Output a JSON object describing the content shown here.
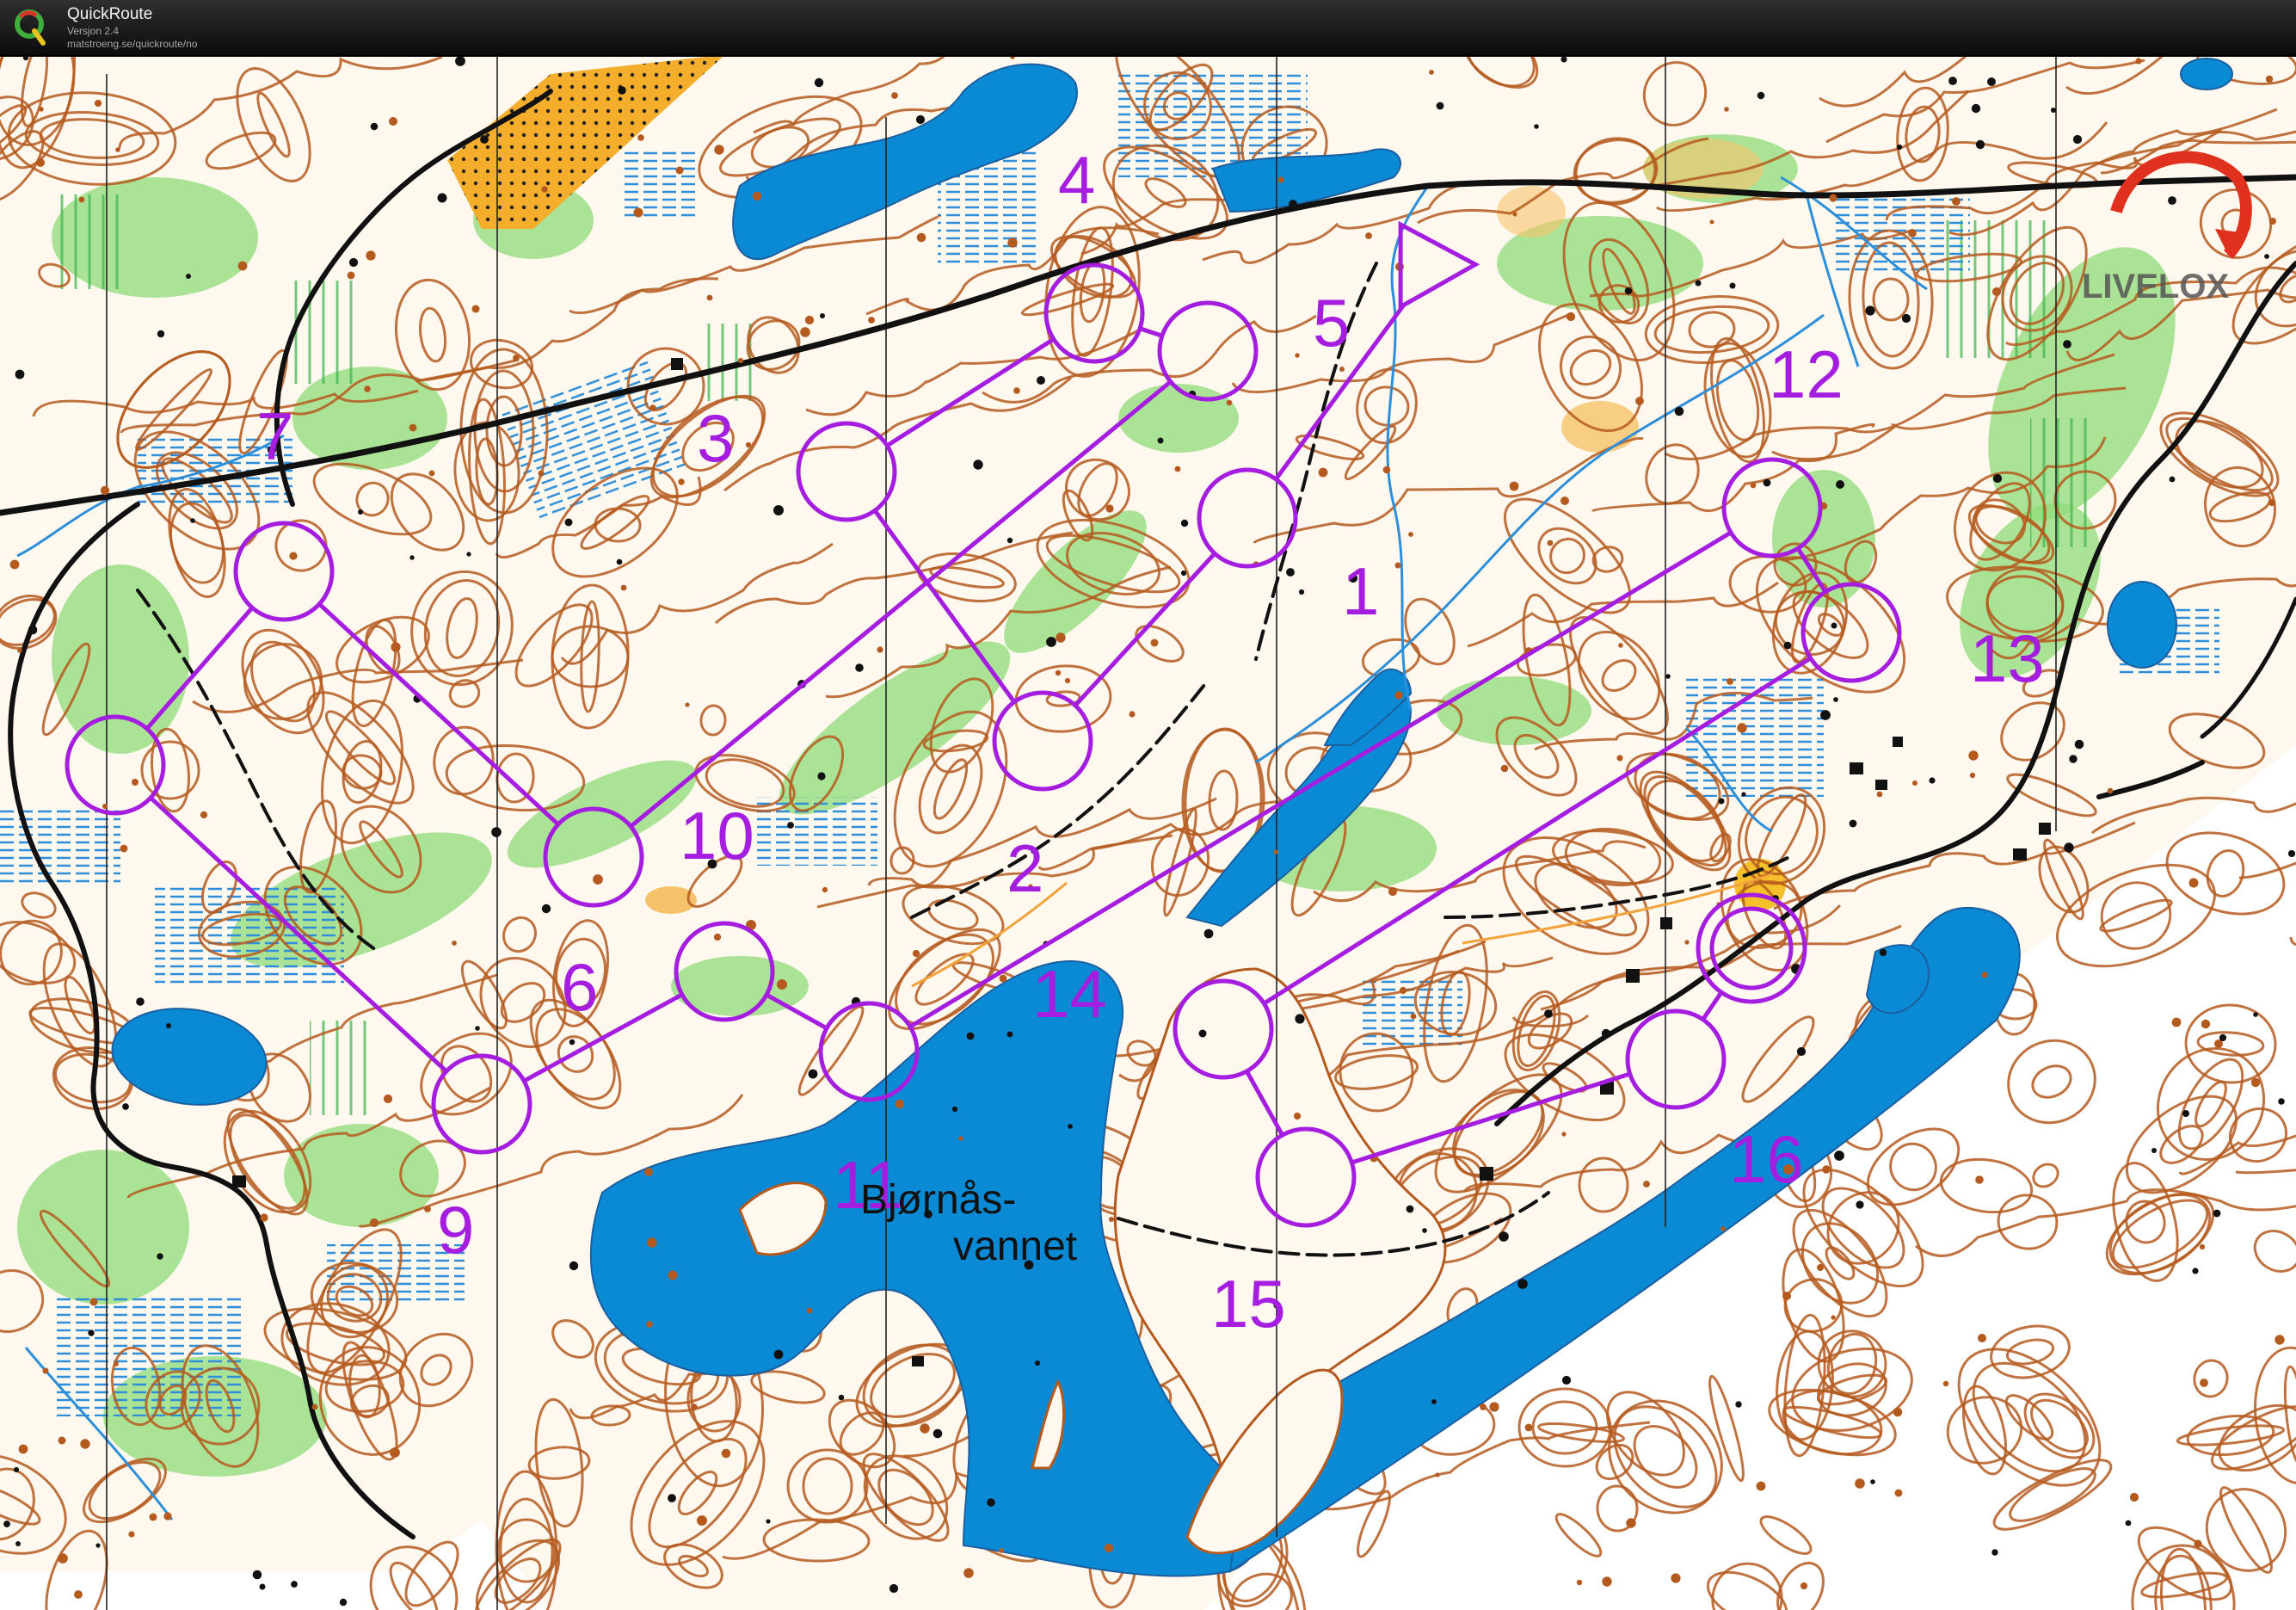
{
  "app": {
    "name": "QuickRoute",
    "version": "Versjon 2.4",
    "url": "matstroeng.se/quickroute/no"
  },
  "map": {
    "lake_label_line1": "Bjørnås-",
    "lake_label_line2": "vannet",
    "logo_text": "LIVELOX",
    "colors": {
      "course": "#a51ee0",
      "water": "#0a8ad4",
      "contour": "#b55a1e",
      "vegetation": "#7fd36a",
      "open_land": "#f7b84a",
      "terrain": "#fff7ee",
      "marsh": "#2d8fd9",
      "road": "#111111"
    },
    "controls": [
      {
        "id": "start",
        "label": "",
        "type": "start"
      },
      {
        "id": "c1",
        "label": "1",
        "type": "control"
      },
      {
        "id": "c2",
        "label": "2",
        "type": "control"
      },
      {
        "id": "c3",
        "label": "3",
        "type": "control"
      },
      {
        "id": "c4",
        "label": "4",
        "type": "control"
      },
      {
        "id": "c5",
        "label": "5",
        "type": "control"
      },
      {
        "id": "c6",
        "label": "6",
        "type": "control"
      },
      {
        "id": "c7",
        "label": "7",
        "type": "control"
      },
      {
        "id": "c8",
        "label": "",
        "type": "control"
      },
      {
        "id": "c9",
        "label": "9",
        "type": "control"
      },
      {
        "id": "c10",
        "label": "10",
        "type": "control"
      },
      {
        "id": "c11",
        "label": "11",
        "type": "control"
      },
      {
        "id": "c12",
        "label": "12",
        "type": "control"
      },
      {
        "id": "c13",
        "label": "13",
        "type": "control"
      },
      {
        "id": "c14",
        "label": "14",
        "type": "control"
      },
      {
        "id": "c15",
        "label": "15",
        "type": "control"
      },
      {
        "id": "c16",
        "label": "16",
        "type": "control"
      },
      {
        "id": "finish",
        "label": "",
        "type": "finish"
      }
    ]
  }
}
